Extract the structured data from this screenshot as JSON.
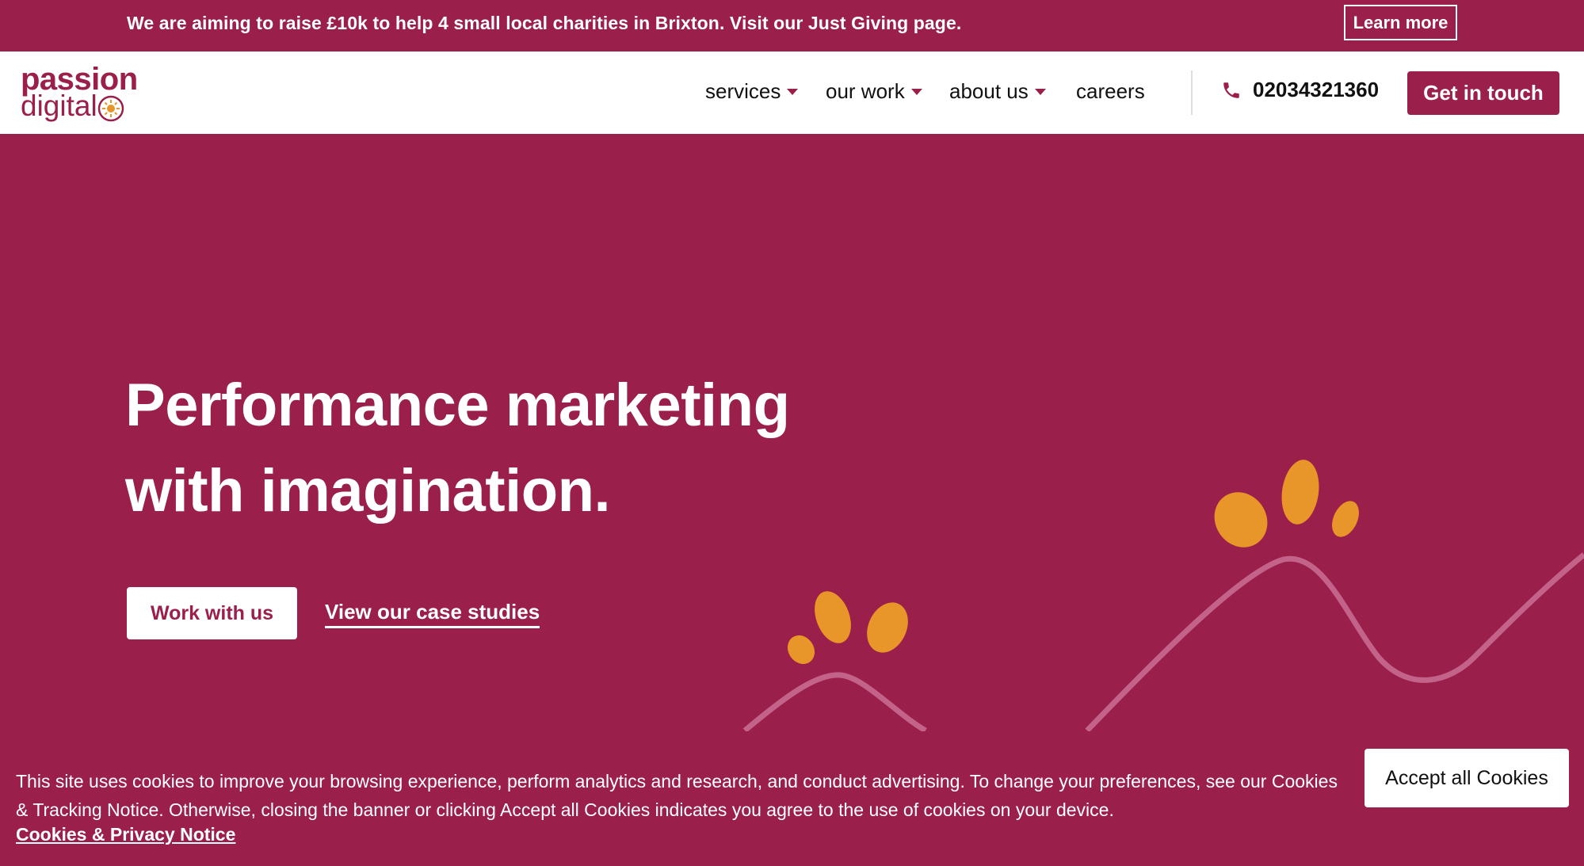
{
  "banner": {
    "message": "We are aiming to raise £10k to help 4 small local charities in Brixton. Visit our Just Giving page.",
    "button_label": "Learn more"
  },
  "header": {
    "logo_line1": "passion",
    "logo_line2": "digital",
    "nav": [
      {
        "label": "services",
        "has_dropdown": true
      },
      {
        "label": "our work",
        "has_dropdown": true
      },
      {
        "label": "about us",
        "has_dropdown": true
      },
      {
        "label": "careers",
        "has_dropdown": false
      }
    ],
    "phone": "02034321360",
    "cta_label": "Get in touch"
  },
  "hero": {
    "title_line1": "Performance marketing",
    "title_line2": "with imagination.",
    "primary_button": "Work with us",
    "secondary_link": "View our case studies"
  },
  "cookie": {
    "text": "This site uses cookies to improve your browsing experience, perform analytics and research, and conduct advertising. To change your preferences, see our Cookies & Tracking Notice. Otherwise, closing the banner or clicking Accept all Cookies indicates you agree to the use of cookies on your device.",
    "link": "Cookies & Privacy Notice",
    "accept_button": "Accept all Cookies"
  },
  "colors": {
    "brand": "#9a1f4b",
    "accent": "#e8962a",
    "wave": "#c4638a"
  },
  "icons": [
    "phone-icon",
    "chevron-down-icon",
    "logo-sun-icon"
  ]
}
